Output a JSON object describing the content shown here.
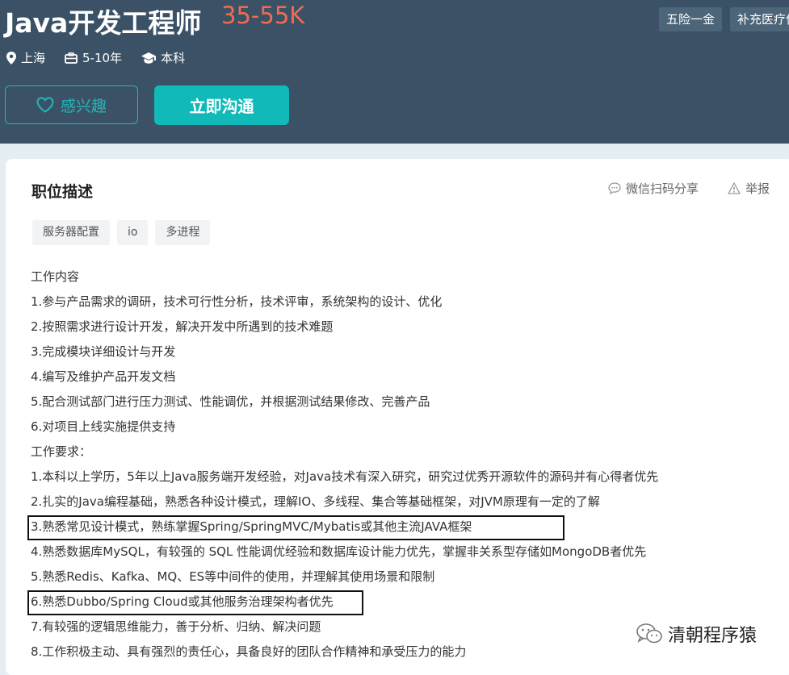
{
  "job": {
    "title": "Java开发工程师",
    "salary": "35-55K",
    "benefits": [
      "五险一金",
      "补充医疗保"
    ],
    "location": "上海",
    "experience": "5-10年",
    "education": "本科"
  },
  "actions": {
    "interested_label": "感兴趣",
    "chat_label": "立即沟通"
  },
  "section": {
    "title": "职位描述",
    "share_label": "微信扫码分享",
    "report_label": "举报",
    "tags": [
      "服务器配置",
      "io",
      "多进程"
    ]
  },
  "description": [
    "工作内容",
    "1.参与产品需求的调研，技术可行性分析，技术评审，系统架构的设计、优化",
    "2.按照需求进行设计开发，解决开发中所遇到的技术难题",
    "3.完成模块详细设计与开发",
    "4.编写及维护产品开发文档",
    "5.配合测试部门进行压力测试、性能调优，并根据测试结果修改、完善产品",
    "6.对项目上线实施提供支持",
    "工作要求：",
    "1.本科以上学历，5年以上Java服务端开发经验，对Java技术有深入研究，研究过优秀开源软件的源码并有心得者优先",
    "2.扎实的Java编程基础，熟悉各种设计模式，理解IO、多线程、集合等基础框架，对JVM原理有一定的了解",
    "3.熟悉常见设计模式，熟练掌握Spring/SpringMVC/Mybatis或其他主流JAVA框架",
    "4.熟悉数据库MySQL，有较强的 SQL 性能调优经验和数据库设计能力优先，掌握非关系型存储如MongoDB者优先",
    "5.熟悉Redis、Kafka、MQ、ES等中间件的使用，并理解其使用场景和限制",
    "6.熟悉Dubbo/Spring Cloud或其他服务治理架构者优先",
    "7.有较强的逻辑思维能力，善于分析、归纳、解决问题",
    "8.工作积极主动、具有强烈的责任心，具备良好的团队合作精神和承受压力的能力"
  ],
  "watermark": "清朝程序猿",
  "colors": {
    "header_bg": "#3b5266",
    "accent": "#12b9b9",
    "salary": "#f26b4f"
  }
}
